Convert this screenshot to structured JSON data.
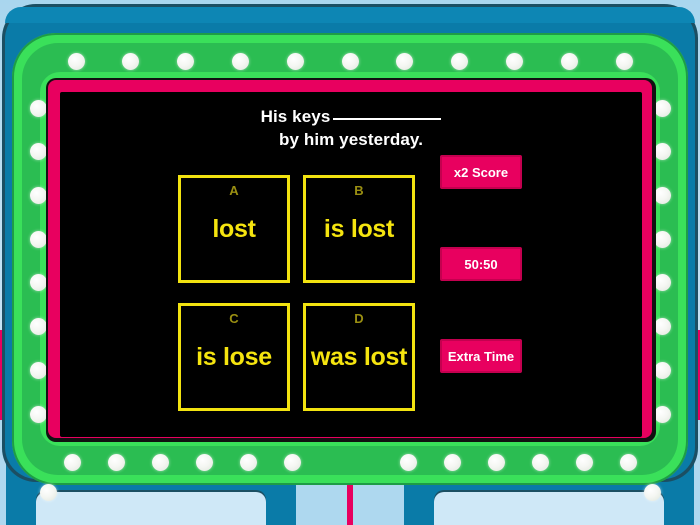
{
  "quiz": {
    "question_line_1_prefix": "His keys",
    "question_line_2": "by him yesterday.",
    "answers": [
      {
        "letter": "A",
        "text": "lost"
      },
      {
        "letter": "B",
        "text": "is lost"
      },
      {
        "letter": "C",
        "text": "is lose"
      },
      {
        "letter": "D",
        "text": "was lost"
      }
    ],
    "powerups": [
      {
        "id": "x2-score",
        "label": "x2 Score"
      },
      {
        "id": "fifty-fifty",
        "label": "50:50"
      },
      {
        "id": "extra-time",
        "label": "Extra Time"
      }
    ]
  },
  "colors": {
    "backdrop": "#aed8ef",
    "cabinet_teal": "#0a7ba8",
    "cabinet_outline": "#1b4f63",
    "marquee_green_light": "#3ae05a",
    "marquee_green_mid": "#2bbd52",
    "bezel_pink": "#e8005f",
    "screen_black": "#000000",
    "answer_yellow": "#f5e40f",
    "answer_letter_olive": "#9a8f12",
    "bulb_white": "#ffffff",
    "question_text": "#ffffff"
  },
  "bulbs": {
    "top_row_count": 11,
    "bottom_row_left_count": 6,
    "bottom_row_right_count": 6,
    "left_column_count": 8,
    "right_column_count": 8
  }
}
